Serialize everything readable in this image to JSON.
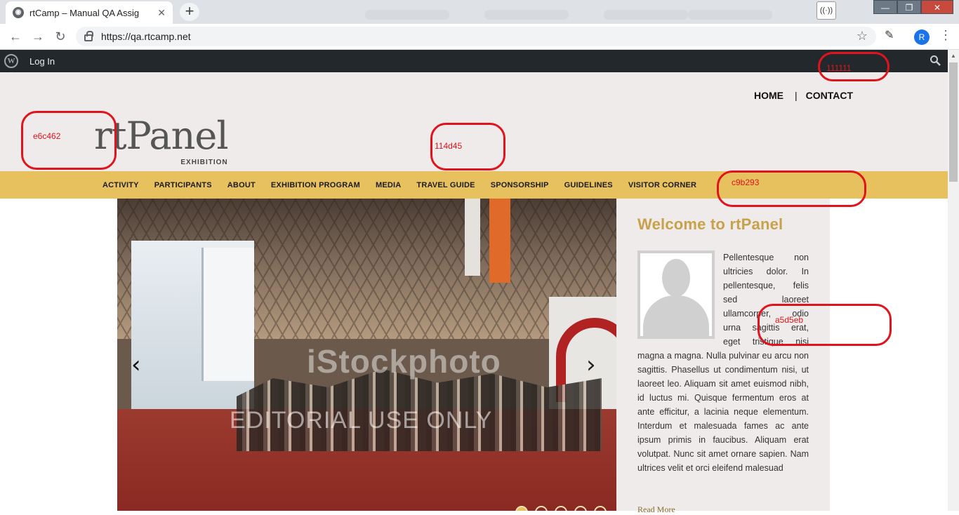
{
  "browser": {
    "tab_title": "rtCamp – Manual QA Assig",
    "url": "https://qa.rtcamp.net",
    "profile_initial": "R"
  },
  "adminbar": {
    "login_label": "Log In"
  },
  "header": {
    "top_nav": [
      "HOME",
      "CONTACT"
    ],
    "logo_text": "rtPanel",
    "logo_subtitle": "EXHIBITION"
  },
  "main_nav": [
    "ACTIVITY",
    "PARTICIPANTS",
    "ABOUT",
    "EXHIBITION PROGRAM",
    "MEDIA",
    "TRAVEL GUIDE",
    "SPONSORSHIP",
    "GUIDELINES",
    "VISITOR CORNER"
  ],
  "slider": {
    "watermark": "iStockphoto",
    "watermark_note": "EDITORIAL USE ONLY",
    "prev_label": "‹",
    "next_label": "›"
  },
  "sidebar": {
    "title": "Welcome to rtPanel",
    "body": "Pellentesque non ultricies dolor. In pellentesque, felis sed laoreet ullamcorper, odio urna sagittis erat, eget tristique nisi magna a magna. Nulla pulvinar eu arcu non sagittis. Phasellus ut condimentum nisi, ut laoreet leo. Aliquam sit amet euismod nibh, id luctus mi. Quisque fermentum eros at ante efficitur, a lacinia neque elementum. Interdum et malesuada fames ac ante ipsum primis in faucibus. Aliquam erat volutpat. Nunc sit amet ornare sapien. Nam ultrices velit et orci eleifend malesuad",
    "read_more": "Read More"
  },
  "annotations": [
    "111111",
    "e6c462",
    "114d45",
    "c9b293",
    "a5d5eb"
  ],
  "colors": {
    "header_bg": "#efebeb",
    "nav_bg": "#e8c15f",
    "title_gold": "#c9a14a",
    "adminbar_bg": "#23282d",
    "annotation_red": "#e0141c"
  }
}
